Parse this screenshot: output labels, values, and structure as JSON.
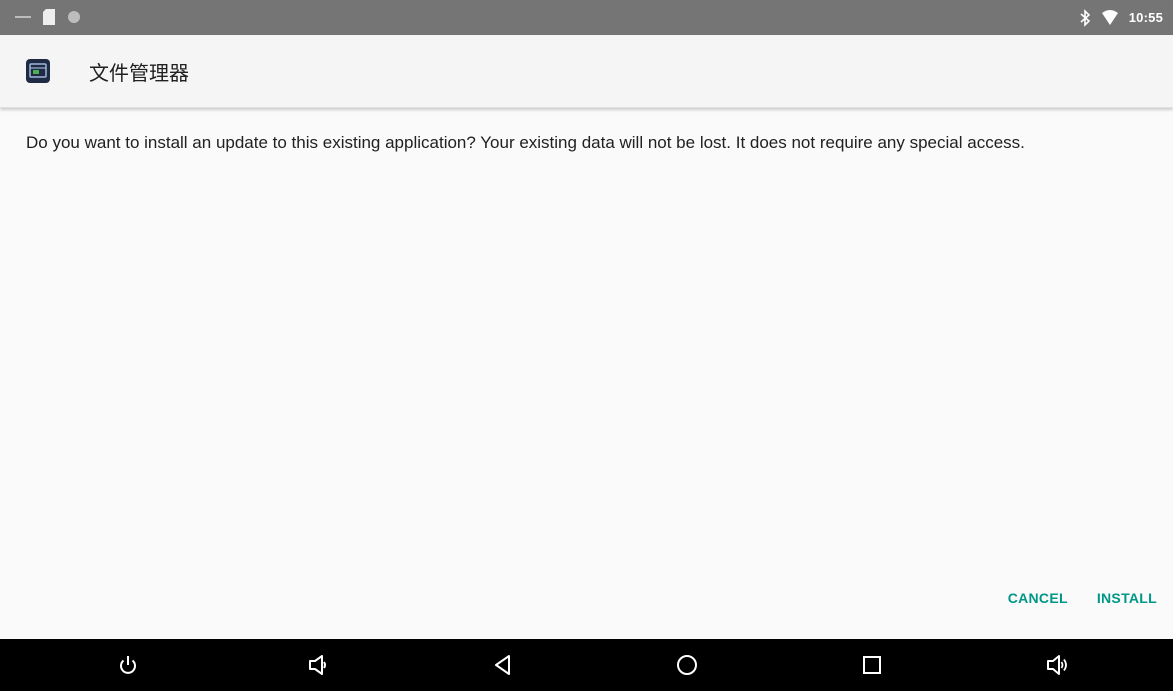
{
  "status_bar": {
    "left_icons": [
      "minus-icon",
      "sd-card-icon",
      "circle-icon"
    ],
    "right_icons": [
      "bluetooth-icon",
      "wifi-icon"
    ],
    "time": "10:55"
  },
  "header": {
    "app_icon": "file-manager-icon",
    "title": "文件管理器"
  },
  "message": "Do you want to install an update to this existing application? Your existing data will not be lost. It does not require any special access.",
  "actions": {
    "cancel_label": "CANCEL",
    "install_label": "INSTALL"
  },
  "nav_bar": {
    "buttons": [
      "power-icon",
      "volume-down-icon",
      "back-icon",
      "home-icon",
      "recents-icon",
      "volume-up-icon"
    ]
  },
  "colors": {
    "status_bar": "#757575",
    "accent": "#009688",
    "nav_bar": "#000000"
  }
}
